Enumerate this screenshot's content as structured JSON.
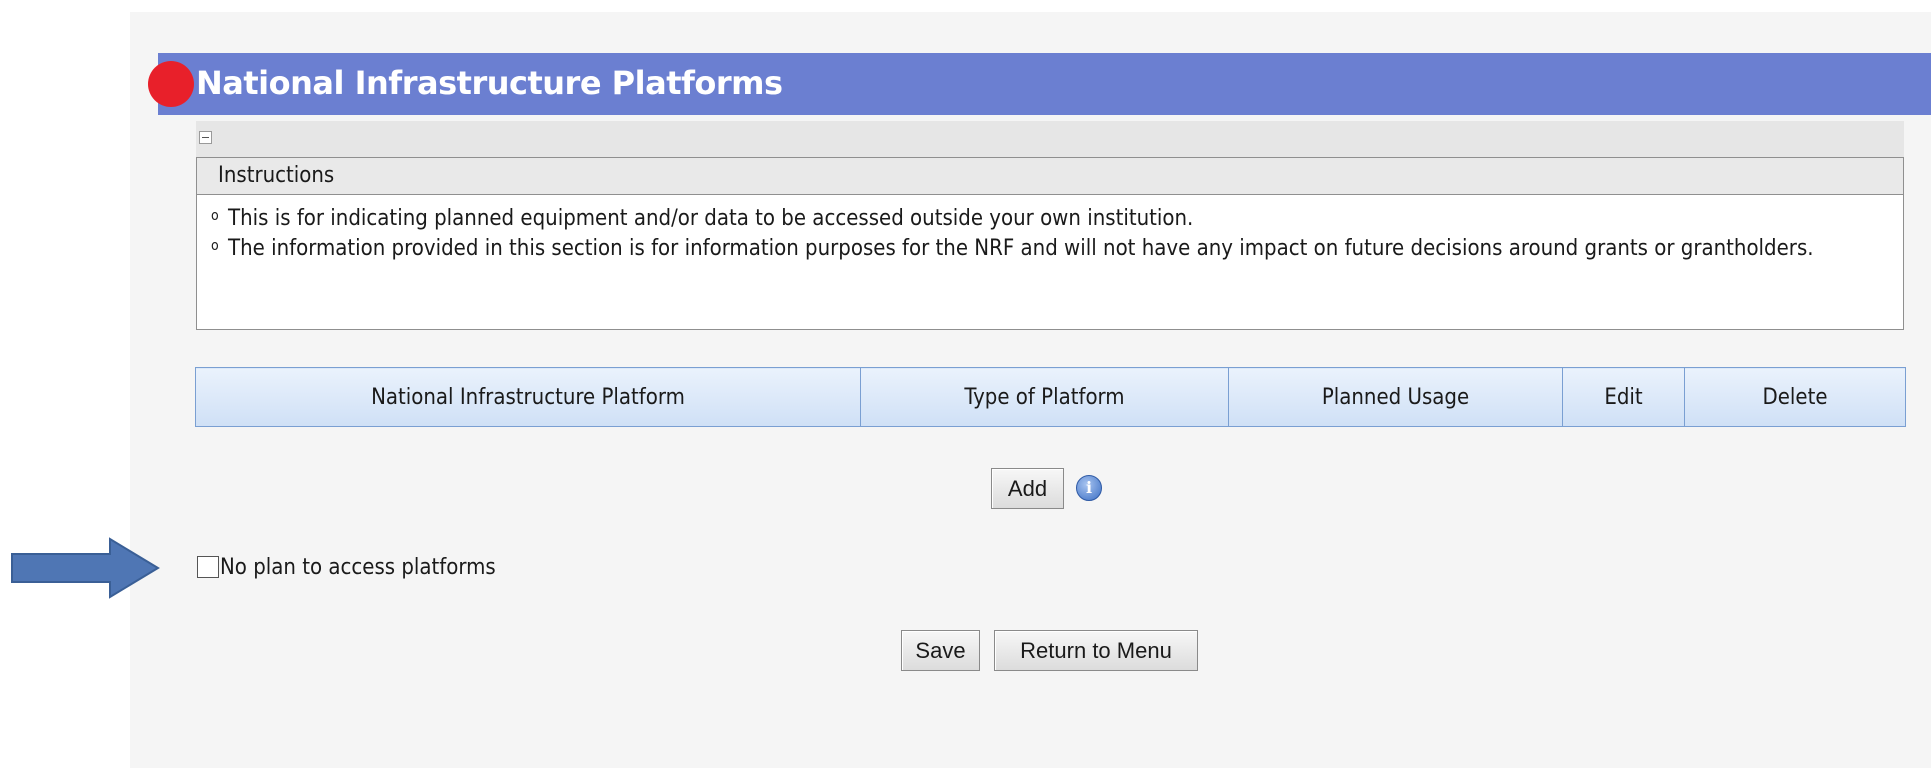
{
  "page": {
    "title": "National Infrastructure Platforms"
  },
  "instructions": {
    "header": "Instructions",
    "items": [
      "This is for indicating planned equipment and/or data to be accessed outside your own institution.",
      "The information provided in this section is for information purposes for the NRF and will not have any impact on future decisions around grants or grantholders."
    ]
  },
  "table": {
    "columns": [
      "National Infrastructure Platform",
      "Type of Platform",
      "Planned Usage",
      "Edit",
      "Delete"
    ]
  },
  "actions": {
    "add_label": "Add",
    "info_icon": "i",
    "save_label": "Save",
    "return_label": "Return to Menu"
  },
  "no_plan": {
    "label": "No plan to access platforms",
    "checked": false
  },
  "colors": {
    "title_bar": "#6b7fd1",
    "title_dot": "#e8202a",
    "table_header": "#cfe0f6",
    "arrow": "#4f76b4"
  }
}
